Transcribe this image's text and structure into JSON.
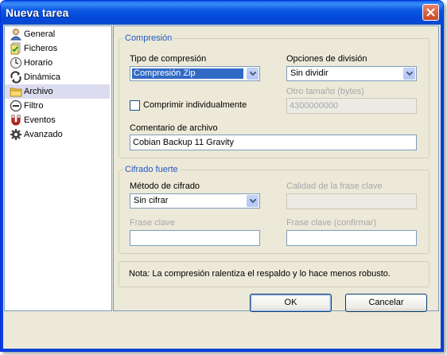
{
  "window": {
    "title": "Nueva tarea"
  },
  "sidebar": {
    "items": [
      {
        "label": "General",
        "icon": "user-icon"
      },
      {
        "label": "Ficheros",
        "icon": "files-icon"
      },
      {
        "label": "Horario",
        "icon": "clock-icon"
      },
      {
        "label": "Dinámica",
        "icon": "dynamic-icon"
      },
      {
        "label": "Archivo",
        "icon": "folder-icon",
        "selected": true
      },
      {
        "label": "Filtro",
        "icon": "filter-icon"
      },
      {
        "label": "Eventos",
        "icon": "magnet-icon"
      },
      {
        "label": "Avanzado",
        "icon": "gear-icon"
      }
    ]
  },
  "compression": {
    "group_title": "Compresión",
    "type_label": "Tipo de compresión",
    "type_value": "Compresión Zip",
    "split_label": "Opciones de división",
    "split_value": "Sin dividir",
    "other_size_label": "Otro tamaño (bytes)",
    "other_size_value": "4300000000",
    "individual_label": "Comprimir individualmente",
    "individual_checked": false,
    "comment_label": "Comentario de archivo",
    "comment_value": "Cobian Backup 11 Gravity"
  },
  "encryption": {
    "group_title": "Cifrado fuerte",
    "method_label": "Método de cifrado",
    "method_value": "Sin cifrar",
    "quality_label": "Calidad de la frase clave",
    "passphrase_label": "Frase clave",
    "passphrase_confirm_label": "Frase clave (confirmar)"
  },
  "note": {
    "text": "Nota: La compresión ralentiza el respaldo y lo hace menos robusto."
  },
  "buttons": {
    "ok": "OK",
    "cancel": "Cancelar"
  },
  "colors": {
    "titlebar": "#0348d8",
    "group_title": "#2457c3",
    "selection": "#316ac5"
  }
}
